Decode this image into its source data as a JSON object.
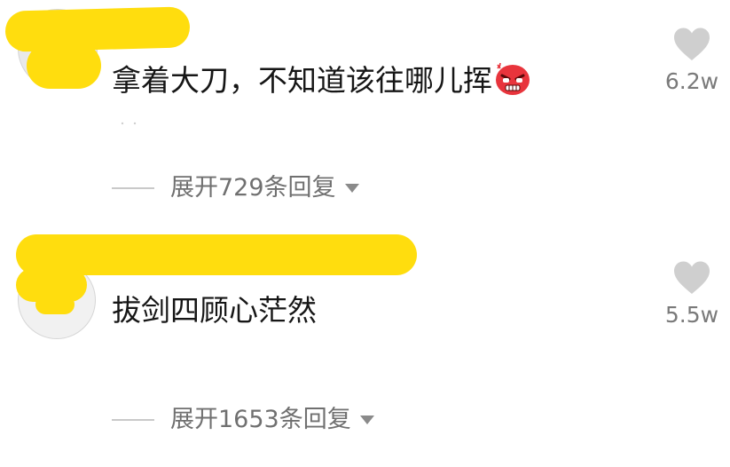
{
  "comments": [
    {
      "text": "拿着大刀，不知道该往哪儿挥",
      "emoji": "angry-face-emoji",
      "likes": "6.2w",
      "expand_label": "展开729条回复"
    },
    {
      "text": "拔剑四顾心茫然",
      "likes": "5.5w",
      "expand_label": "展开1653条回复"
    }
  ],
  "colors": {
    "redaction": "#ffdd0e",
    "text": "#161616",
    "muted": "#707070",
    "heart": "#cfcfcf",
    "emoji_red": "#e8343c"
  }
}
